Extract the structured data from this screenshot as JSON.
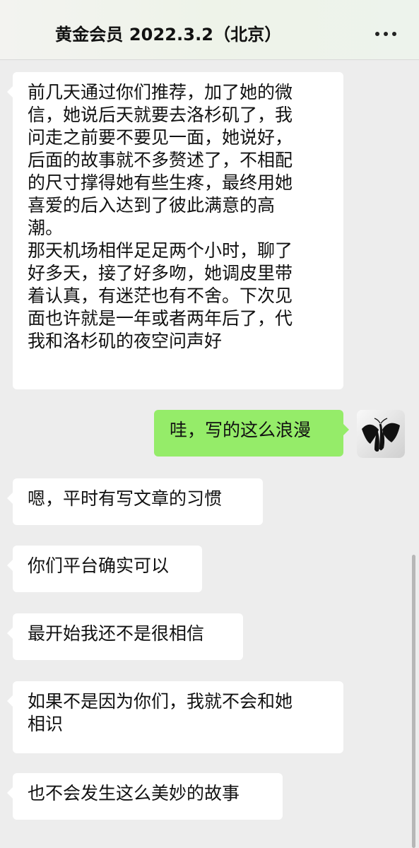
{
  "header": {
    "title": "黄金会员 2022.3.2（北京）",
    "more_icon": "more-dots-icon"
  },
  "messages": [
    {
      "side": "left",
      "text": "前几天通过你们推荐，加了她的微\n信，她说后天就要去洛杉矶了，我\n问走之前要不要见一面，她说好，\n后面的故事就不多赘述了，不相配\n的尺寸撑得她有些生疼，最终用她\n喜爱的后入达到了彼此满意的高\n潮。\n那天机场相伴足足两个小时，聊了\n好多天，接了好多吻，她调皮里带\n着认真，有迷茫也有不舍。下次见\n面也许就是一年或者两年后了，代\n我和洛杉矶的夜空问声好"
    },
    {
      "side": "right",
      "text": "哇，写的这么浪漫",
      "avatar_icon": "butterfly-icon"
    },
    {
      "side": "left",
      "text": "嗯，平时有写文章的习惯"
    },
    {
      "side": "left",
      "text": "你们平台确实可以"
    },
    {
      "side": "left",
      "text": "最开始我还不是很相信"
    },
    {
      "side": "left",
      "text": "如果不是因为你们，我就不会和她\n相识"
    },
    {
      "side": "left",
      "text": "也不会发生这么美妙的故事"
    }
  ],
  "colors": {
    "background": "#ededed",
    "bubble_left": "#ffffff",
    "bubble_right": "#95ec69"
  }
}
